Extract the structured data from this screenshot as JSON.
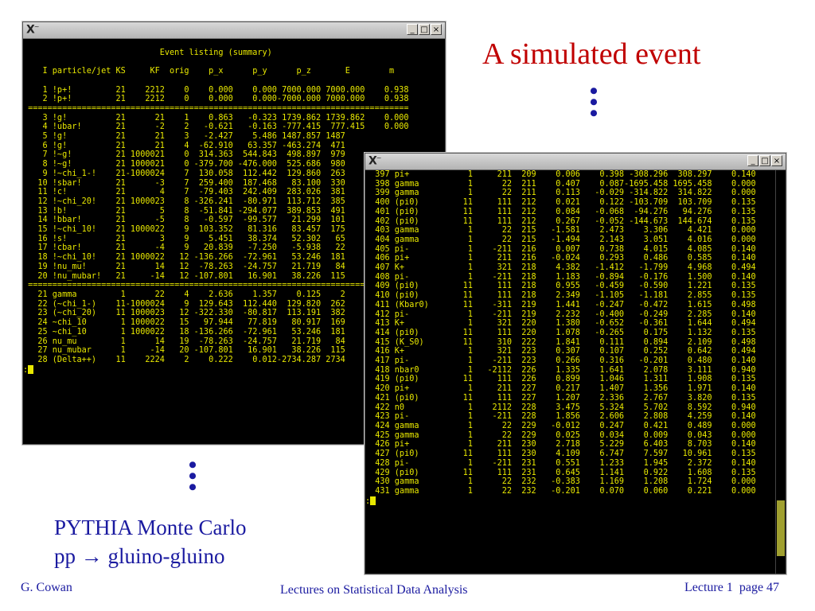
{
  "slide": {
    "heading": "A simulated event",
    "caption_line1": "PYTHIA Monte Carlo",
    "caption_line2": "pp → gluino-gluino",
    "footer_author": "G. Cowan",
    "footer_course": "Lectures on Statistical Data Analysis",
    "footer_page": "Lecture 1  page 47",
    "vdots": "•\n•\n•"
  },
  "window1": {
    "logo": "X",
    "logo_sup": "~",
    "btn_min": "_",
    "btn_max": "□",
    "btn_close": "×",
    "prompt": ":",
    "lines": [
      "",
      "                            Event listing (summary)",
      "",
      "    I particle/jet KS     KF  orig    p_x      p_y      p_z       E        m",
      "",
      "    1 !p+!         21    2212    0    0.000    0.000 7000.000 7000.000    0.938",
      "    2 !p+!         21    2212    0    0.000    0.000-7000.000 7000.000    0.938",
      " ==============================================================================",
      "    3 !g!          21      21    1    0.863   -0.323 1739.862 1739.862    0.000",
      "    4 !ubar!       21      -2    2   -0.621   -0.163 -777.415  777.415    0.000",
      "    5 !g!          21      21    3   -2.427    5.486 1487.857 1487",
      "    6 !g!          21      21    4  -62.910   63.357 -463.274  471",
      "    7 !~g!         21 1000021    0  314.363  544.843  498.897  979",
      "    8 !~g!         21 1000021    0 -379.700 -476.000  525.686  980",
      "    9 !~chi_1-!    21-1000024    7  130.058  112.442  129.860  263",
      "   10 !sbar!       21      -3    7  259.400  187.468   83.100  330",
      "   11 !c!          21       4    7  -79.403  242.409  283.026  381",
      "   12 !~chi_20!    21 1000023    8 -326.241  -80.971  113.712  385",
      "   13 !b!          21       5    8  -51.841 -294.077  389.853  491",
      "   14 !bbar!       21      -5    8   -0.597  -99.577   21.299  101",
      "   15 !~chi_10!    21 1000022    9  103.352   81.316   83.457  175",
      "   16 !s!          21       3    9    5.451   38.374   52.302   65",
      "   17 !cbar!       21      -4    9   20.839   -7.250   -5.938   22",
      "   18 !~chi_10!    21 1000022   12 -136.266  -72.961   53.246  181",
      "   19 !nu_mu!      21      14   12  -78.263  -24.757   21.719   84",
      "   20 !nu_mubar!   21     -14   12 -107.801   16.901   38.226  115",
      " ==============================================================================",
      "   21 gamma         1      22    4    2.636    1.357    0.125    2",
      "   22 (~chi_1-)    11-1000024    9  129.643  112.440  129.820  262",
      "   23 (~chi_20)    11 1000023   12 -322.330  -80.817  113.191  382",
      "   24 ~chi_10       1 1000022   15   97.944   77.819   80.917  169",
      "   25 ~chi_10       1 1000022   18 -136.266  -72.961   53.246  181",
      "   26 nu_mu         1      14   19  -78.263  -24.757   21.719   84",
      "   27 nu_mubar      1     -14   20 -107.801   16.901   38.226  115",
      "   28 (Delta++)    11    2224    2    0.222    0.012-2734.287 2734"
    ]
  },
  "window2": {
    "logo": "X",
    "logo_sup": "~",
    "btn_min": "_",
    "btn_max": "□",
    "btn_close": "×",
    "prompt": ":",
    "scroll_position": 0.95,
    "lines": [
      "  397 pi+            1     211  209    0.006    0.398 -308.296  308.297    0.140",
      "  398 gamma          1      22  211    0.407    0.087-1695.458 1695.458    0.000",
      "  399 gamma          1      22  211    0.113   -0.029 -314.822  314.822    0.000",
      "  400 (pi0)         11     111  212    0.021    0.122 -103.709  103.709    0.135",
      "  401 (pi0)         11     111  212    0.084   -0.068  -94.276   94.276    0.135",
      "  402 (pi0)         11     111  212    0.267   -0.052 -144.673  144.674    0.135",
      "  403 gamma          1      22  215   -1.581    2.473    3.306    4.421    0.000",
      "  404 gamma          1      22  215   -1.494    2.143    3.051    4.016    0.000",
      "  405 pi-            1    -211  216    0.007    0.738    4.015    4.085    0.140",
      "  406 pi+            1     211  216   -0.024    0.293    0.486    0.585    0.140",
      "  407 K+             1     321  218    4.382   -1.412   -1.799    4.968    0.494",
      "  408 pi-            1    -211  218    1.183   -0.894   -0.176    1.500    0.140",
      "  409 (pi0)         11     111  218    0.955   -0.459   -0.590    1.221    0.135",
      "  410 (pi0)         11     111  218    2.349   -1.105   -1.181    2.855    0.135",
      "  411 (Kbar0)       11    -311  219    1.441   -0.247   -0.472    1.615    0.498",
      "  412 pi-            1    -211  219    2.232   -0.400   -0.249    2.285    0.140",
      "  413 K+             1     321  220    1.380   -0.652   -0.361    1.644    0.494",
      "  414 (pi0)         11     111  220    1.078   -0.265    0.175    1.132    0.135",
      "  415 (K_S0)        11     310  222    1.841    0.111    0.894    2.109    0.498",
      "  416 K+             1     321  223    0.307    0.107    0.252    0.642    0.494",
      "  417 pi-            1    -211  223    0.266    0.316   -0.201    0.480    0.140",
      "  418 nbar0          1   -2112  226    1.335    1.641    2.078    3.111    0.940",
      "  419 (pi0)         11     111  226    0.899    1.046    1.311    1.908    0.135",
      "  420 pi+            1     211  227    0.217    1.407    1.356    1.971    0.140",
      "  421 (pi0)         11     111  227    1.207    2.336    2.767    3.820    0.135",
      "  422 n0             1    2112  228    3.475    5.324    5.702    8.592    0.940",
      "  423 pi-            1    -211  228    1.856    2.606    2.808    4.259    0.140",
      "  424 gamma          1      22  229   -0.012    0.247    0.421    0.489    0.000",
      "  425 gamma          1      22  229    0.025    0.034    0.009    0.043    0.000",
      "  426 pi+            1     211  230    2.718    5.229    6.403    8.703    0.140",
      "  427 (pi0)         11     111  230    4.109    6.747    7.597   10.961    0.135",
      "  428 pi-            1    -211  231    0.551    1.233    1.945    2.372    0.140",
      "  429 (pi0)         11     111  231    0.645    1.141    0.922    1.608    0.135",
      "  430 gamma          1      22  232   -0.383    1.169    1.208    1.724    0.000",
      "  431 gamma          1      22  232   -0.201    0.070    0.060    0.221    0.000"
    ]
  },
  "colors": {
    "terminal_text": "#e8e800",
    "terminal_bg": "#000000",
    "heading": "#c00000",
    "body_text": "#1a1aa0"
  }
}
